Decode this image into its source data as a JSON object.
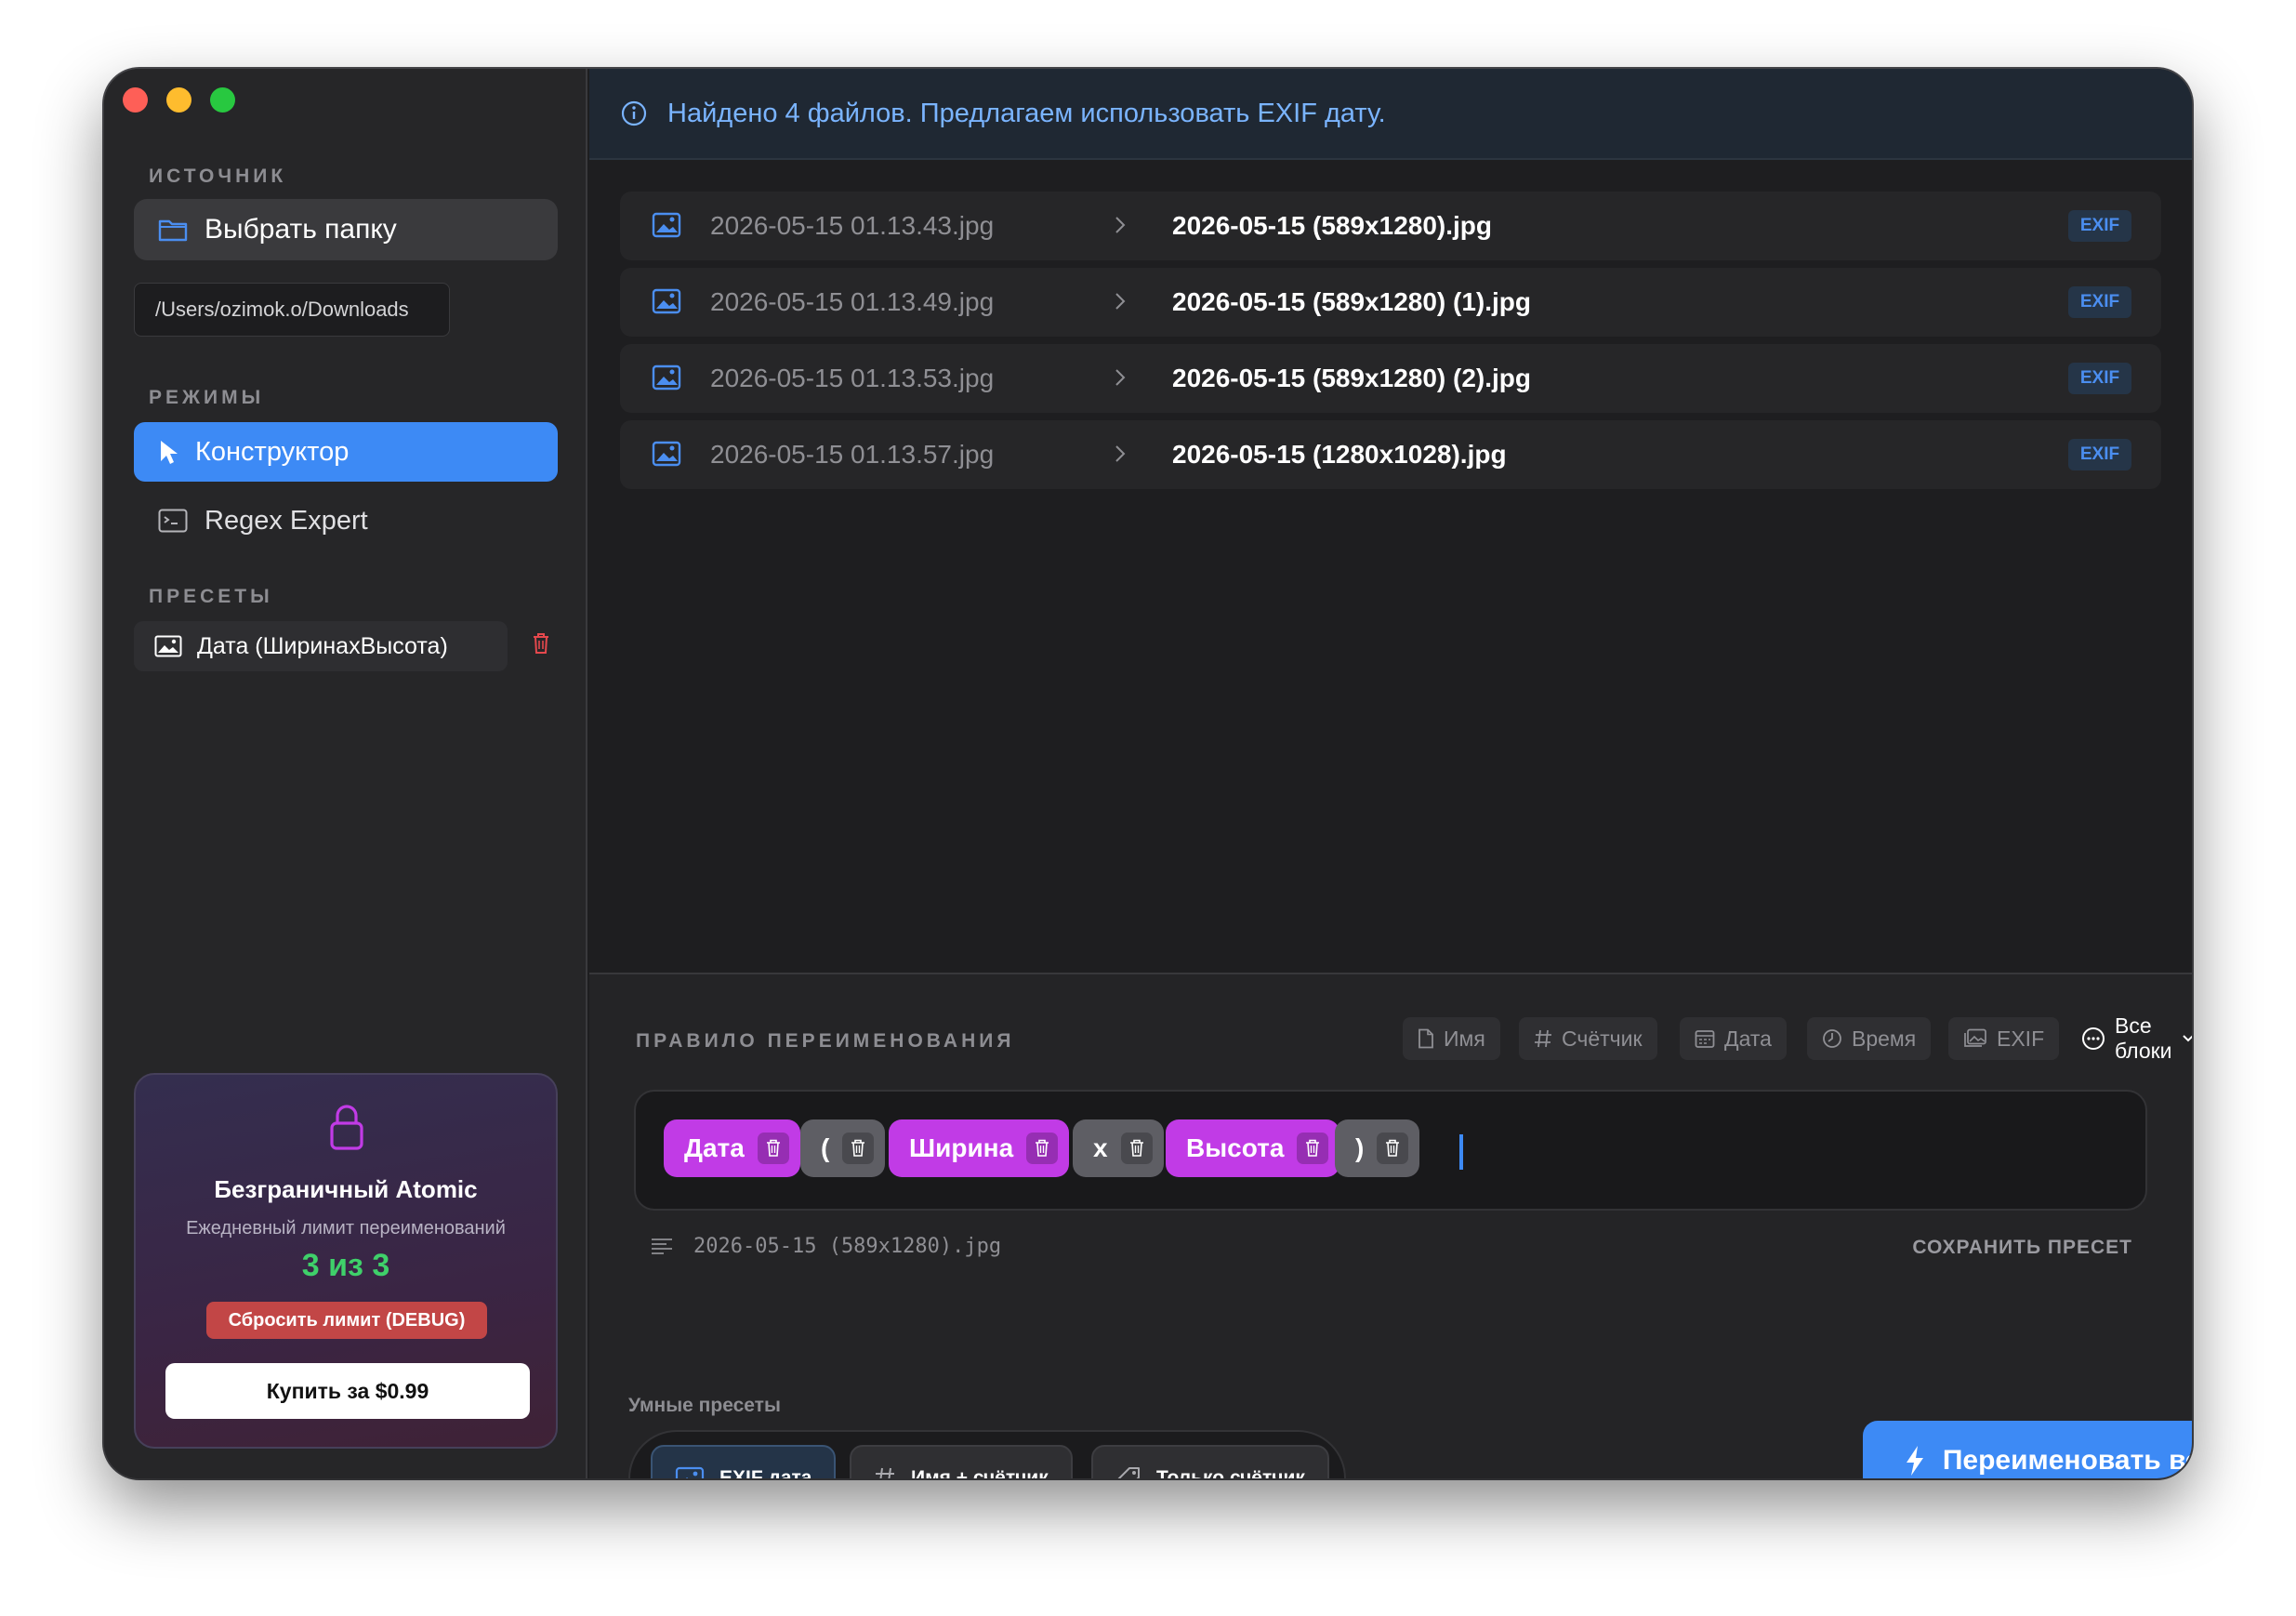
{
  "sidebar": {
    "source_label": "ИСТОЧНИК",
    "choose_folder": "Выбрать папку",
    "folder_path": "/Users/ozimok.o/Downloads",
    "modes_label": "РЕЖИМЫ",
    "modes": [
      {
        "label": "Конструктор",
        "icon": "cursor-icon",
        "active": true
      },
      {
        "label": "Regex Expert",
        "icon": "terminal-icon",
        "active": false
      }
    ],
    "presets_label": "ПРЕСЕТЫ",
    "presets": [
      {
        "label": "Дата (ШиринахВысота)",
        "icon": "photo-icon"
      }
    ]
  },
  "promo": {
    "title": "Безграничный Atomic",
    "subtitle": "Ежедневный лимит переименований",
    "count": "3 из 3",
    "reset_button": "Сбросить лимит (DEBUG)",
    "buy_button": "Купить за $0.99",
    "colors": {
      "count": "#3fd06a",
      "reset": "#c24646"
    }
  },
  "banner": {
    "text": "Найдено 4 файлов. Предлагаем использовать EXIF дату.",
    "icon": "info-icon",
    "color": "#7ab4ff"
  },
  "files": [
    {
      "old": "2026-05-15 01.13.43.jpg",
      "new": "2026-05-15 (589x1280).jpg",
      "badge": "EXIF"
    },
    {
      "old": "2026-05-15 01.13.49.jpg",
      "new": "2026-05-15 (589x1280) (1).jpg",
      "badge": "EXIF"
    },
    {
      "old": "2026-05-15 01.13.53.jpg",
      "new": "2026-05-15 (589x1280) (2).jpg",
      "badge": "EXIF"
    },
    {
      "old": "2026-05-15 01.13.57.jpg",
      "new": "2026-05-15 (1280x1028).jpg",
      "badge": "EXIF"
    }
  ],
  "rule": {
    "label": "ПРАВИЛО ПЕРЕИМЕНОВАНИЯ",
    "block_buttons": [
      {
        "label": "Имя",
        "icon": "document-icon"
      },
      {
        "label": "Счётчик",
        "icon": "hash-icon"
      },
      {
        "label": "Дата",
        "icon": "calendar-icon"
      },
      {
        "label": "Время",
        "icon": "clock-icon"
      },
      {
        "label": "EXIF",
        "icon": "photos-icon"
      }
    ],
    "all_blocks": "Все блоки",
    "tokens": [
      {
        "label": "Дата",
        "kind": "pink"
      },
      {
        "label": "(",
        "kind": "gray"
      },
      {
        "label": "Ширина",
        "kind": "pink"
      },
      {
        "label": "x",
        "kind": "gray"
      },
      {
        "label": "Высота",
        "kind": "pink"
      },
      {
        "label": ")",
        "kind": "gray"
      }
    ],
    "preview": "2026-05-15 (589x1280).jpg",
    "save_preset": "СОХРАНИТЬ ПРЕСЕТ",
    "colors": {
      "token_pink": "#c13be6",
      "token_gray": "#5e5e64",
      "accent": "#3d8af5"
    }
  },
  "smart_presets": {
    "label": "Умные пресеты",
    "items": [
      {
        "label": "EXIF дата",
        "icon": "photo-icon",
        "selected": true
      },
      {
        "label": "Имя + счётчик",
        "icon": "hash-icon",
        "selected": false
      },
      {
        "label": "Только счётчик",
        "icon": "tag-icon",
        "selected": false
      }
    ]
  },
  "rename_all": "Переименовать всё"
}
